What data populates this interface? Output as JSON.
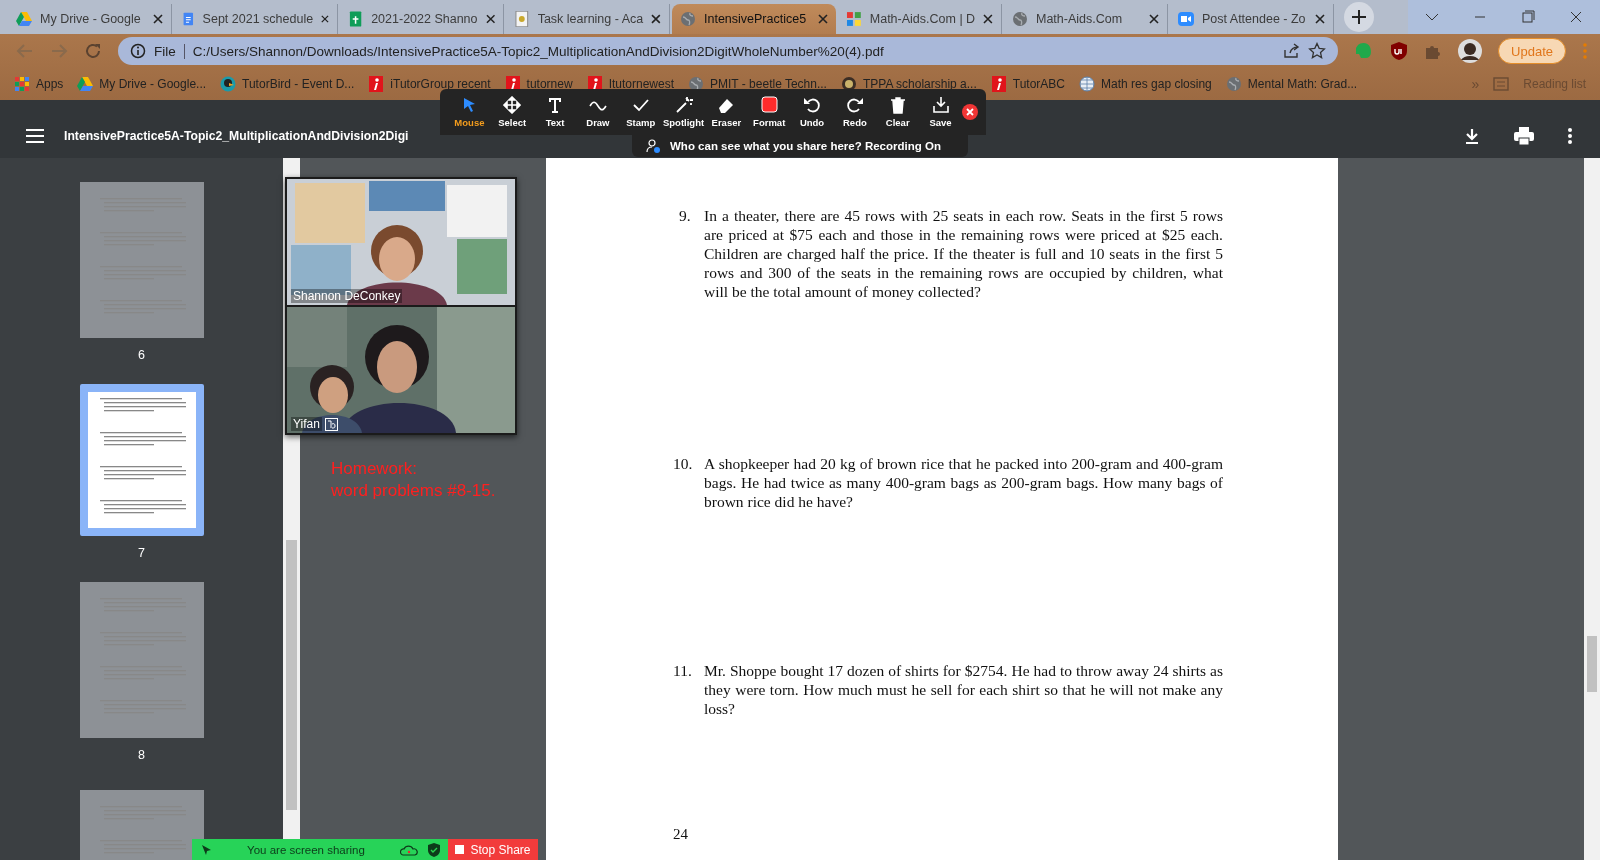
{
  "browser": {
    "tabs": [
      {
        "title": "My Drive - Google",
        "selected": false
      },
      {
        "title": "Sept 2021 schedule",
        "selected": false
      },
      {
        "title": "2021-2022 Shanno",
        "selected": false
      },
      {
        "title": "Task learning - Aca",
        "selected": false
      },
      {
        "title": "IntensivePractice5",
        "selected": true
      },
      {
        "title": "Math-Aids.Com | D",
        "selected": false
      },
      {
        "title": "Math-Aids.Com",
        "selected": false
      },
      {
        "title": "Post Attendee - Zo",
        "selected": false
      }
    ],
    "address": {
      "scheme": "File",
      "url": "C:/Users/Shannon/Downloads/IntensivePractice5A-Topic2_MultiplicationAndDivision2DigitWholeNumber%20(4).pdf"
    },
    "update_button": "Update",
    "bookmarks": [
      "Apps",
      "My Drive - Google...",
      "TutorBird - Event D...",
      "iTutorGroup recent",
      "tutornew",
      "Itutornewest",
      "PMIT - beetle Techn...",
      "TPPA scholarship a...",
      "TutorABC",
      "Math res gap closing",
      "Mental Math: Grad..."
    ],
    "more_bookmarks": "»",
    "reading_list": "Reading list"
  },
  "pdf_viewer": {
    "title": "IntensivePractice5A-Topic2_MultiplicationAndDivision2Digi",
    "thumbnails": [
      {
        "page": "6",
        "selected": false
      },
      {
        "page": "7",
        "selected": true
      },
      {
        "page": "8",
        "selected": false
      },
      {
        "kind": "partial",
        "selected": false
      }
    ],
    "page": {
      "problems": [
        {
          "number": "9.",
          "text": "In a theater, there are 45 rows with 25 seats in each row. Seats in the first 5 rows are priced at $75 each and those in the remaining rows were priced at $25 each. Children are charged half the price. If the theater is full and 10 seats in the first 5 rows and 300 of the seats in the remaining rows are occupied by children, what will be the total amount of money collected?"
        },
        {
          "number": "10.",
          "text": "A shopkeeper had 20 kg of brown rice that he packed into 200-gram and 400-gram bags. He had twice as many 400-gram bags as 200-gram bags. How many bags of brown rice did he have?"
        },
        {
          "number": "11.",
          "text": "Mr. Shoppe bought 17 dozen of shirts for $2754. He had to throw away 24 shirts as they were torn. How much must he sell for each shirt so that he will not make any loss?"
        }
      ],
      "page_number": "24"
    }
  },
  "zoom": {
    "tools": [
      {
        "label": "Mouse",
        "selected": true
      },
      {
        "label": "Select",
        "selected": false
      },
      {
        "label": "Text",
        "selected": false
      },
      {
        "label": "Draw",
        "selected": false
      },
      {
        "label": "Stamp",
        "selected": false
      },
      {
        "label": "Spotlight",
        "selected": false
      },
      {
        "label": "Eraser",
        "selected": false
      },
      {
        "label": "Format",
        "selected": false
      },
      {
        "label": "Undo",
        "selected": false
      },
      {
        "label": "Redo",
        "selected": false
      },
      {
        "label": "Clear",
        "selected": false
      },
      {
        "label": "Save",
        "selected": false
      }
    ],
    "notice": "Who can see what you share here? Recording On",
    "videos": [
      {
        "name": "Shannon DeConkey"
      },
      {
        "name": "Yifan"
      }
    ],
    "annotation": [
      "Homework:",
      "word problems #8-15."
    ],
    "share_bar": {
      "status": "You are screen sharing",
      "stop_button": "Stop Share"
    }
  }
}
